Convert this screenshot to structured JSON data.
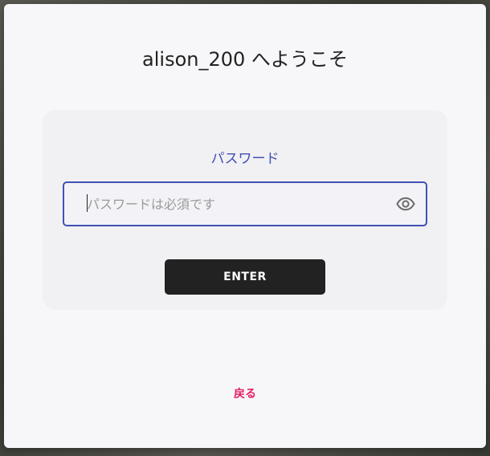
{
  "dialog": {
    "title": "alison_200 へようこそ"
  },
  "password_card": {
    "label": "パスワード",
    "input_value": "",
    "input_placeholder": "パスワードは必須です",
    "visibility_icon": "eye-icon",
    "submit_label": "ENTER"
  },
  "footer": {
    "back_label": "戻る"
  },
  "colors": {
    "accent": "#3f51b5",
    "button_bg": "#222222",
    "link": "#e91e63",
    "dialog_bg": "#f7f7f9",
    "card_bg": "#f1f1f3"
  }
}
